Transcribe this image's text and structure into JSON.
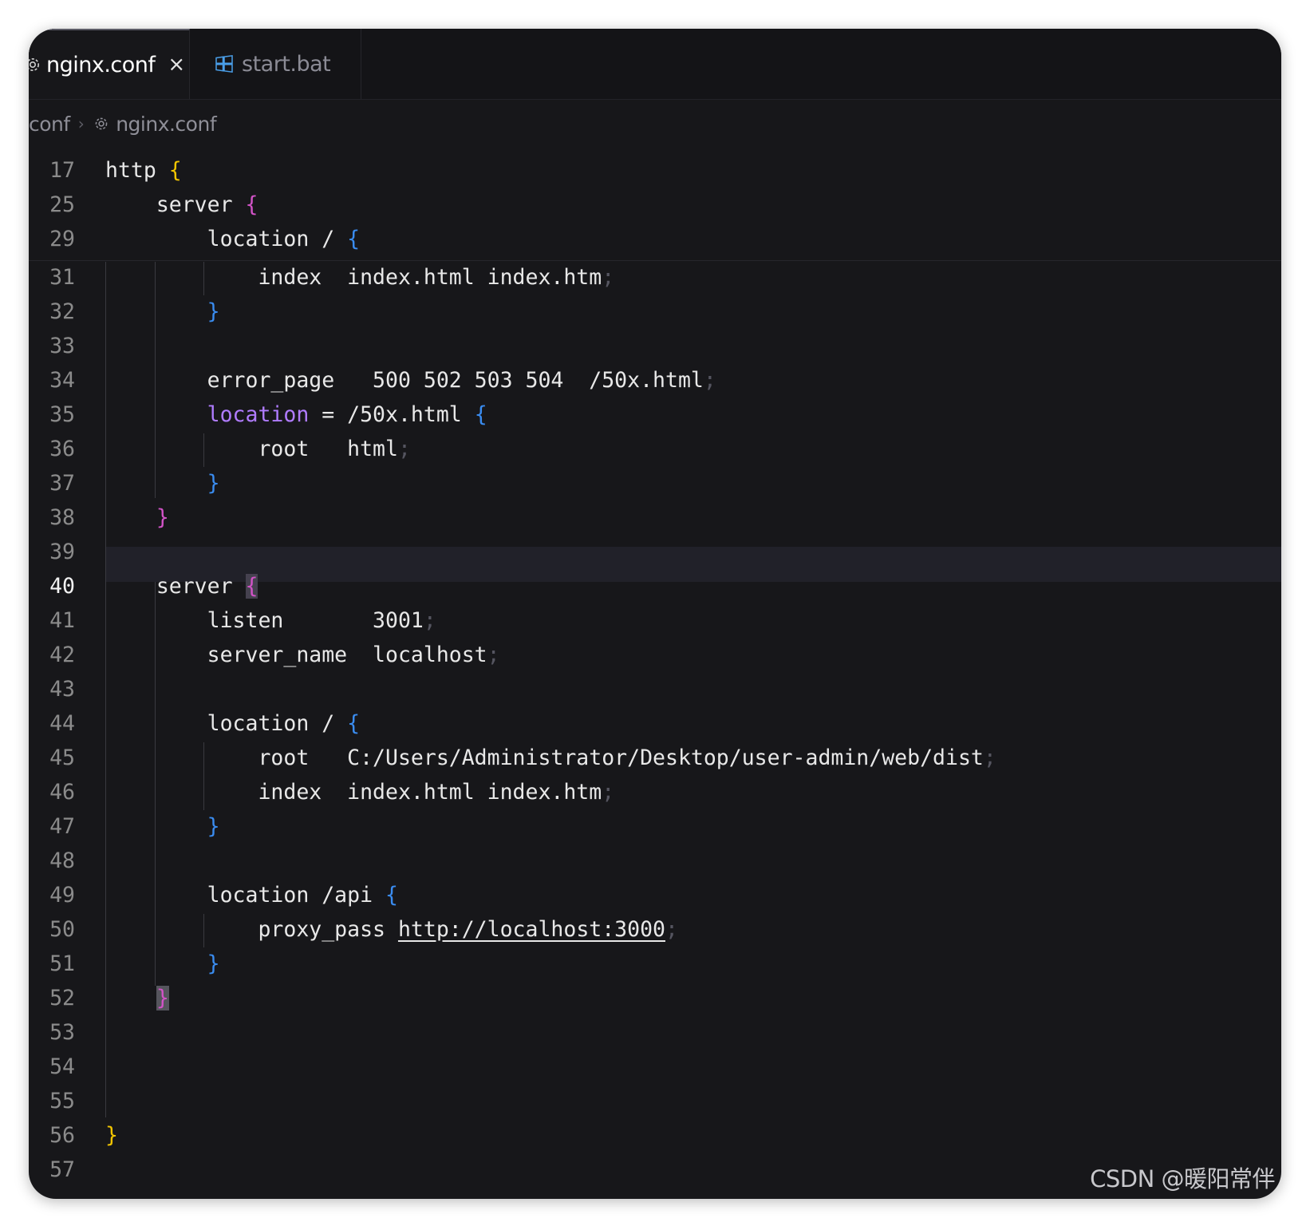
{
  "tabs": [
    {
      "label": "nginx.conf",
      "icon": "gear-icon",
      "active": true,
      "close": "×"
    },
    {
      "label": "start.bat",
      "icon": "windows-icon",
      "active": false
    }
  ],
  "breadcrumb": {
    "folder": "conf",
    "separator": "›",
    "file": "nginx.conf",
    "file_icon": "gear-icon"
  },
  "editor": {
    "current_line": 40,
    "lines": [
      {
        "num": "17",
        "code": "http {"
      },
      {
        "num": "25",
        "code": "    server {"
      },
      {
        "num": "29",
        "code": "        location / {"
      },
      {
        "num": "31",
        "code": "            index  index.html index.htm;"
      },
      {
        "num": "32",
        "code": "        }"
      },
      {
        "num": "33",
        "code": ""
      },
      {
        "num": "34",
        "code": "        error_page   500 502 503 504  /50x.html;"
      },
      {
        "num": "35",
        "code": "        location = /50x.html {"
      },
      {
        "num": "36",
        "code": "            root   html;"
      },
      {
        "num": "37",
        "code": "        }"
      },
      {
        "num": "38",
        "code": "    }"
      },
      {
        "num": "39",
        "code": ""
      },
      {
        "num": "40",
        "code": "    server {"
      },
      {
        "num": "41",
        "code": "        listen       3001;"
      },
      {
        "num": "42",
        "code": "        server_name  localhost;"
      },
      {
        "num": "43",
        "code": ""
      },
      {
        "num": "44",
        "code": "        location / {"
      },
      {
        "num": "45",
        "code": "            root   C:/Users/Administrator/Desktop/user-admin/web/dist;"
      },
      {
        "num": "46",
        "code": "            index  index.html index.htm;"
      },
      {
        "num": "47",
        "code": "        }"
      },
      {
        "num": "48",
        "code": ""
      },
      {
        "num": "49",
        "code": "        location /api {"
      },
      {
        "num": "50",
        "code": "            proxy_pass http://localhost:3000;"
      },
      {
        "num": "51",
        "code": "        }"
      },
      {
        "num": "52",
        "code": "    }"
      },
      {
        "num": "53",
        "code": ""
      },
      {
        "num": "54",
        "code": ""
      },
      {
        "num": "55",
        "code": ""
      },
      {
        "num": "56",
        "code": "}"
      },
      {
        "num": "57",
        "code": ""
      }
    ]
  },
  "colors": {
    "background": "#17171a",
    "brace_level1": "#f2c500",
    "brace_level2": "#d253c7",
    "brace_level3": "#3a8cf0",
    "keyword_location_highlight": "#b07cff",
    "text": "#e8e8e8",
    "line_number": "#8b8b8b"
  },
  "watermark": "CSDN @暖阳常伴"
}
